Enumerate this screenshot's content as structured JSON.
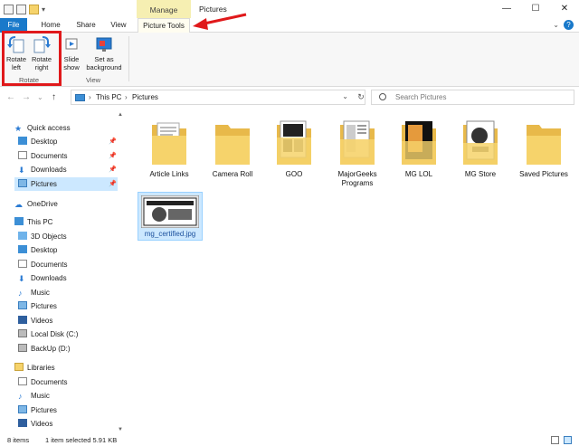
{
  "window": {
    "title": "Pictures",
    "context_tab": "Manage",
    "controls": [
      "—",
      "☐",
      "✕"
    ]
  },
  "tabs": {
    "file": "File",
    "home": "Home",
    "share": "Share",
    "view": "View",
    "picture_tools": "Picture Tools"
  },
  "ribbon": {
    "rotate_left_line1": "Rotate",
    "rotate_left_line2": "left",
    "rotate_right_line1": "Rotate",
    "rotate_right_line2": "right",
    "slide_show_line1": "Slide",
    "slide_show_line2": "show",
    "set_bg_line1": "Set as",
    "set_bg_line2": "background",
    "group_rotate": "Rotate",
    "group_view": "View"
  },
  "address": {
    "path": [
      "This PC",
      "Pictures"
    ],
    "separator": "›"
  },
  "search": {
    "placeholder": "Search Pictures"
  },
  "nav": {
    "quick_access": "Quick access",
    "qa_items": [
      "Desktop",
      "Documents",
      "Downloads",
      "Pictures"
    ],
    "onedrive": "OneDrive",
    "this_pc": "This PC",
    "pc_items": [
      "3D Objects",
      "Desktop",
      "Documents",
      "Downloads",
      "Music",
      "Pictures",
      "Videos",
      "Local Disk (C:)",
      "BackUp (D:)"
    ],
    "libraries": "Libraries",
    "lib_items": [
      "Documents",
      "Music",
      "Pictures",
      "Videos"
    ]
  },
  "files": [
    {
      "name": "Article Links"
    },
    {
      "name": "Camera Roll"
    },
    {
      "name": "GOO"
    },
    {
      "name": "MajorGeeks Programs"
    },
    {
      "name": "MG LOL"
    },
    {
      "name": "MG Store"
    },
    {
      "name": "Saved Pictures"
    },
    {
      "name": "mg_certified.jpg"
    }
  ],
  "status": {
    "items": "8 items",
    "selected": "1 item selected  5.91 KB"
  },
  "colors": {
    "accent": "#1979ca",
    "folder": "#f6d36b",
    "highlight": "#e0191b",
    "selection": "#cce8ff",
    "context_tab": "#f6efb2"
  }
}
